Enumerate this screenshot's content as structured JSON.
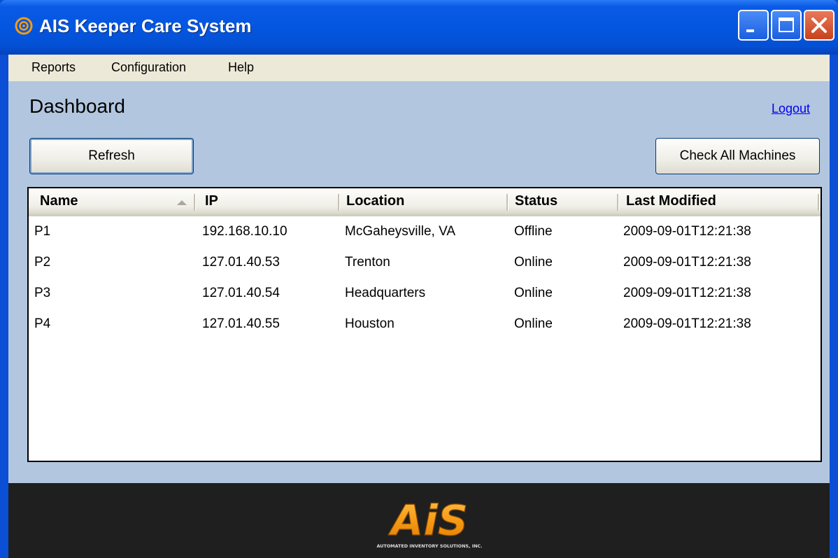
{
  "window": {
    "title": "AIS Keeper Care System"
  },
  "menu": {
    "items": [
      "Reports",
      "Configuration",
      "Help"
    ]
  },
  "page": {
    "title": "Dashboard",
    "logout_label": "Logout"
  },
  "toolbar": {
    "refresh_label": "Refresh",
    "check_all_label": "Check All Machines"
  },
  "table": {
    "columns": [
      "Name",
      "IP",
      "Location",
      "Status",
      "Last Modified"
    ],
    "sort_column": "Name",
    "sort_direction": "ascending",
    "rows": [
      [
        "P1",
        "192.168.10.10",
        "McGaheysville, VA",
        "Offline",
        "2009-09-01T12:21:38"
      ],
      [
        "P2",
        "127.01.40.53",
        "Trenton",
        "Online",
        "2009-09-01T12:21:38"
      ],
      [
        "P3",
        "127.01.40.54",
        "Headquarters",
        "Online",
        "2009-09-01T12:21:38"
      ],
      [
        "P4",
        "127.01.40.55",
        "Houston",
        "Online",
        "2009-09-01T12:21:38"
      ]
    ]
  },
  "footer": {
    "logo_text": "AiS",
    "logo_tagline": "AUTOMATED INVENTORY SOLUTIONS, INC."
  },
  "colors": {
    "titlebar": "#0356e0",
    "client_bg": "#b3c6df",
    "menubar": "#ece9d8",
    "footer": "#1f1f1f",
    "logo_orange": "#f39c12",
    "link": "#0000ee"
  }
}
